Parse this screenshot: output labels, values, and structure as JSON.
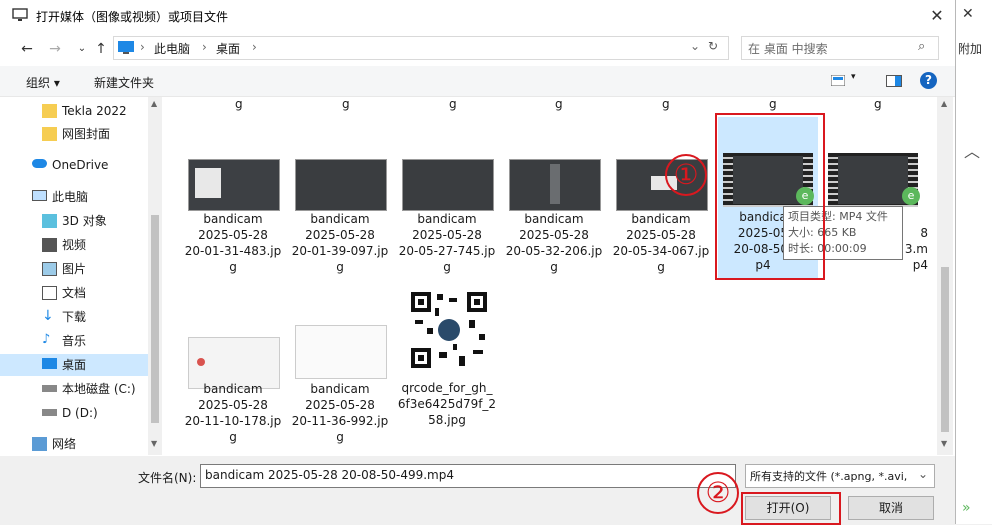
{
  "window": {
    "title": "打开媒体（图像或视频）或项目文件"
  },
  "address": {
    "path": [
      "此电脑",
      "桌面"
    ],
    "search_placeholder": "在 桌面 中搜索"
  },
  "toolbar": {
    "organize": "组织 ▾",
    "new_folder": "新建文件夹"
  },
  "sidebar": {
    "items": [
      "Tekla 2022",
      "网图封面",
      "OneDrive",
      "此电脑",
      "3D 对象",
      "视频",
      "图片",
      "文档",
      "下载",
      "音乐",
      "桌面",
      "本地磁盘 (C:)",
      "D (D:)",
      "网络"
    ]
  },
  "files": {
    "top_partial": [
      "g",
      "g",
      "g",
      "g",
      "g",
      "g",
      "g"
    ],
    "row1": [
      {
        "name": "bandicam\n2025-05-28\n20-01-31-483.jp\ng"
      },
      {
        "name": "bandicam\n2025-05-28\n20-01-39-097.jp\ng"
      },
      {
        "name": "bandicam\n2025-05-28\n20-05-27-745.jp\ng"
      },
      {
        "name": "bandicam\n2025-05-28\n20-05-32-206.jp\ng"
      },
      {
        "name": "bandicam\n2025-05-28\n20-05-34-067.jp\ng"
      },
      {
        "name": "bandica\n2025-05\n20-08-50-\np4"
      },
      {
        "name": "\n8\n3.m\np4"
      }
    ],
    "row2": [
      {
        "name": "bandicam\n2025-05-28\n20-11-10-178.jp\ng"
      },
      {
        "name": "bandicam\n2025-05-28\n20-11-36-992.jp\ng"
      },
      {
        "name": "qrcode_for_gh_\n6f3e6425d79f_2\n58.jpg"
      }
    ]
  },
  "tooltip": {
    "type": "项目类型: MP4 文件",
    "size": "大小: 665 KB",
    "duration": "时长: 00:00:09"
  },
  "bottom": {
    "filename_label": "文件名(N):",
    "filename_value": "bandicam 2025-05-28 20-08-50-499.mp4",
    "filter_value": "所有支持的文件 (*.apng, *.avi,",
    "open_label": "打开(O)",
    "cancel_label": "取消"
  },
  "annotations": {
    "one": "①",
    "two": "②"
  },
  "right_strip": {
    "label": "附加"
  },
  "colors": {
    "selection": "#cce8ff",
    "annotation_red": "#d9181f",
    "accent_blue": "#0078d7"
  }
}
